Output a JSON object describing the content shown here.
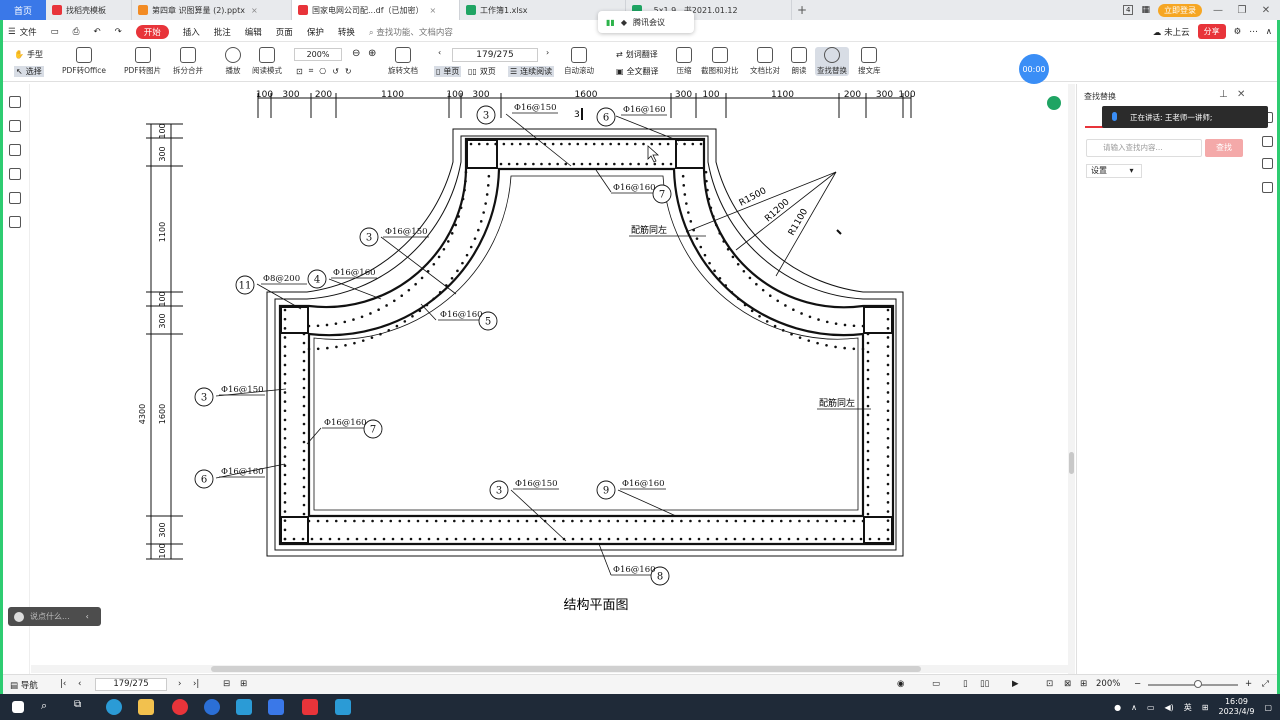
{
  "tabs": {
    "home": "首页",
    "items": [
      {
        "label": "找稻壳模板",
        "color": "#e8343a"
      },
      {
        "label": "第四章  识图算量 (2).pptx",
        "color": "#f28b24"
      },
      {
        "label": "国家电网公司配...df（已加密）",
        "color": "#e8343a"
      },
      {
        "label": "工作簿1.xlsx",
        "color": "#1fa463"
      },
      {
        "label": "...5x1.9...书2021.01.12",
        "color": "#1fa463"
      }
    ],
    "login": "立即登录",
    "page_count_badge": "4"
  },
  "meeting": {
    "label": "腾讯会议"
  },
  "menu": {
    "file": "文件",
    "items": [
      "开始",
      "插入",
      "批注",
      "编辑",
      "页面",
      "保护",
      "转换"
    ],
    "search": "查找功能、文档内容",
    "cloud": "未上云",
    "share": "分享"
  },
  "toolbar": {
    "hand": "手型",
    "select": "选择",
    "tools": [
      "PDF转Office",
      "PDF转图片",
      "拆分合并",
      "播放",
      "阅读模式",
      "旋转文档",
      "单页",
      "双页",
      "连续阅读",
      "自动滚动",
      "划词翻译",
      "全文翻译",
      "压缩",
      "截图和对比",
      "文档比对",
      "朗读",
      "查找替换",
      "搜文库"
    ],
    "zoom": "200%",
    "page": "179/275",
    "timer": "00:00"
  },
  "drawing": {
    "title": "结构平面图",
    "top_dims": [
      "100",
      "300",
      "200",
      "1100",
      "100",
      "300",
      "1600",
      "300",
      "100",
      "1100",
      "200",
      "300",
      "100"
    ],
    "left_dims": [
      "100",
      "300",
      "1100",
      "100",
      "300",
      "1600",
      "4300",
      "300",
      "100"
    ],
    "labels": [
      {
        "num": "3",
        "text": "Φ16@150"
      },
      {
        "num": "6",
        "text": "Φ16@160"
      },
      {
        "num": "7",
        "text": "Φ16@160"
      },
      {
        "num": "3",
        "text": "Φ16@150"
      },
      {
        "num": "11",
        "text": "Φ8@200"
      },
      {
        "num": "4",
        "text": "Φ16@160"
      },
      {
        "num": "5",
        "text": "Φ16@160"
      },
      {
        "num": "3",
        "text": "Φ16@150"
      },
      {
        "num": "7",
        "text": "Φ16@160"
      },
      {
        "num": "6",
        "text": "Φ16@160"
      },
      {
        "num": "3",
        "text": "Φ16@150"
      },
      {
        "num": "9",
        "text": "Φ16@160"
      },
      {
        "num": "8",
        "text": "Φ16@160"
      }
    ],
    "radii": [
      "R1500",
      "R1200",
      "R1100"
    ],
    "notes": [
      "配筋同左",
      "配筋同左"
    ],
    "small3": "3"
  },
  "ask": {
    "placeholder": "说点什么..."
  },
  "panel": {
    "title": "查找替换",
    "speaking": "正在讲话: 王老师一讲师;",
    "search_placeholder": "请输入查找内容...",
    "find": "查找",
    "settings": "设置"
  },
  "status": {
    "nav": "导航",
    "page": "179/275",
    "zoom": "200%"
  },
  "taskbar": {
    "time": "16:09",
    "date": "2023/4/9",
    "lang": "英"
  }
}
